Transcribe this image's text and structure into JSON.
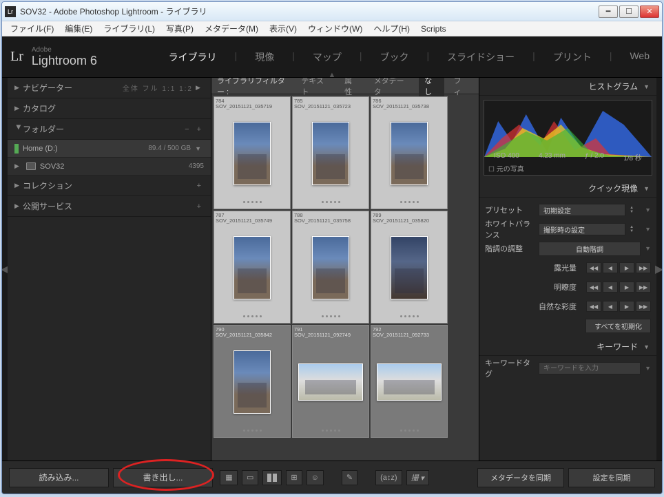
{
  "titlebar": {
    "icon": "Lr",
    "title": "SOV32 - Adobe Photoshop Lightroom - ライブラリ"
  },
  "menubar": [
    "ファイル(F)",
    "編集(E)",
    "ライブラリ(L)",
    "写真(P)",
    "メタデータ(M)",
    "表示(V)",
    "ウィンドウ(W)",
    "ヘルプ(H)",
    "Scripts"
  ],
  "logo": {
    "lr": "Lr",
    "small": "Adobe",
    "main": "Lightroom 6"
  },
  "modules": [
    "ライブラリ",
    "現像",
    "マップ",
    "ブック",
    "スライドショー",
    "プリント",
    "Web"
  ],
  "modules_active": 0,
  "left": {
    "navigator": {
      "label": "ナビゲーター",
      "extras": "全体  フル  1:1  1:2"
    },
    "catalog": {
      "label": "カタログ"
    },
    "folders": {
      "label": "フォルダー",
      "pm": "−  +"
    },
    "drive": {
      "name": "Home (D:)",
      "meta": "89.4 / 500 GB"
    },
    "folder": {
      "name": "SOV32",
      "count": "4395"
    },
    "collections": {
      "label": "コレクション"
    },
    "publish": {
      "label": "公開サービス"
    }
  },
  "filter": {
    "label": "ライブラリフィルター :",
    "items": [
      "テキスト",
      "属性",
      "メタデータ",
      "なし",
      "フィ"
    ],
    "active": 3
  },
  "thumbs": [
    {
      "n": "784",
      "f": "SOV_20151121_035719",
      "sel": true,
      "t": "portrait"
    },
    {
      "n": "785",
      "f": "SOV_20151121_035723",
      "sel": true,
      "t": "portrait"
    },
    {
      "n": "786",
      "f": "SOV_20151121_035738",
      "sel": true,
      "t": "portrait"
    },
    {
      "n": "787",
      "f": "SOV_20151121_035749",
      "sel": true,
      "t": "portrait"
    },
    {
      "n": "788",
      "f": "SOV_20151121_035758",
      "sel": true,
      "t": "portrait"
    },
    {
      "n": "789",
      "f": "SOV_20151121_035820",
      "sel": true,
      "t": "dusk"
    },
    {
      "n": "790",
      "f": "SOV_20151121_035842",
      "sel": false,
      "t": "portrait"
    },
    {
      "n": "791",
      "f": "SOV_20151121_092749",
      "sel": false,
      "t": "wide"
    },
    {
      "n": "792",
      "f": "SOV_20151121_092733",
      "sel": false,
      "t": "wide"
    }
  ],
  "right": {
    "histogram": {
      "label": "ヒストグラム",
      "iso": "ISO 400",
      "focal": "4.23 mm",
      "aperture": "ƒ / 2.0",
      "shutter": "1/8 秒",
      "orig": "元の写真"
    },
    "quickdev": {
      "label": "クイック現像"
    },
    "preset": {
      "label": "プリセット",
      "value": "初期設定"
    },
    "wb": {
      "label": "ホワイトバランス",
      "value": "撮影時の設定"
    },
    "tone": {
      "label": "階調の調整",
      "btn": "自動階調"
    },
    "exposure": "露光量",
    "clarity": "明瞭度",
    "vibrance": "自然な彩度",
    "resetall": "すべてを初期化",
    "keywords": {
      "label": "キーワード"
    },
    "kwtag": {
      "label": "キーワードタグ",
      "placeholder": "キーワードを入力"
    },
    "syncmeta": "メタデータを同期",
    "syncset": "設定を同期"
  },
  "footer": {
    "import": "読み込み...",
    "export": "書き出し..."
  }
}
